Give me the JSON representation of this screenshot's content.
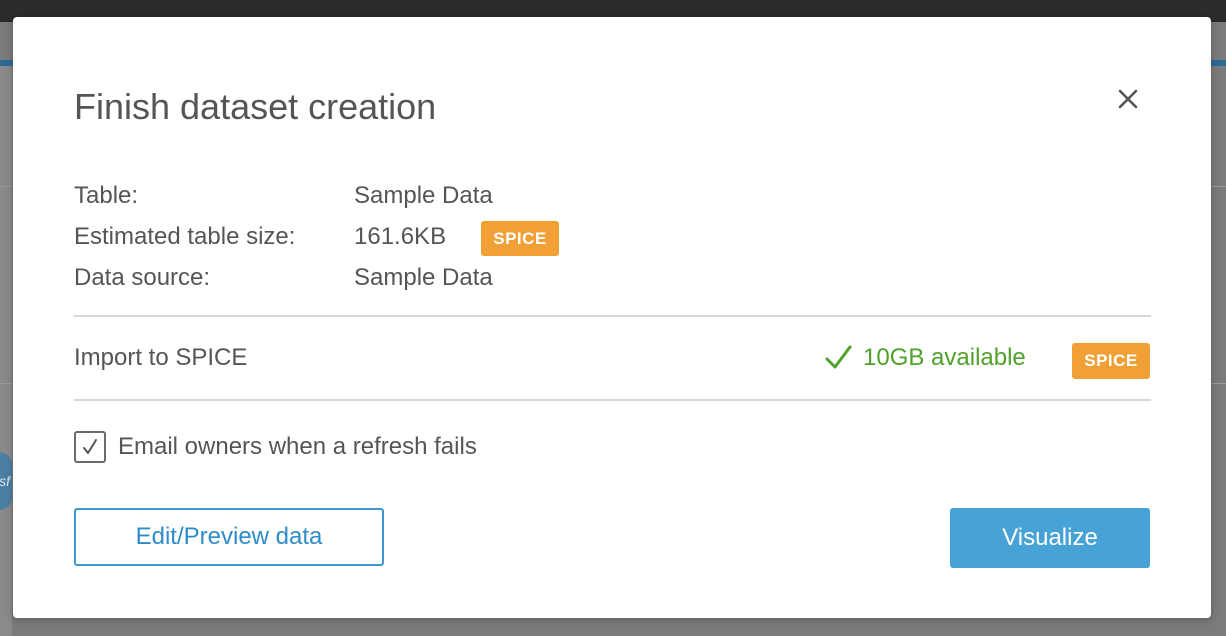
{
  "modal": {
    "title": "Finish dataset creation",
    "close_icon": "close-icon"
  },
  "details": [
    {
      "label": "Table:",
      "value": "Sample Data"
    },
    {
      "label": "Estimated table size:",
      "value": "161.6KB",
      "badge": "SPICE"
    },
    {
      "label": "Data source:",
      "value": "Sample Data"
    }
  ],
  "import": {
    "label": "Import to SPICE",
    "status_icon": "checkmark-icon",
    "available_text": "10GB available",
    "badge": "SPICE"
  },
  "email_option": {
    "checked": true,
    "label": "Email owners when a refresh fails"
  },
  "actions": {
    "edit_preview_label": "Edit/Preview data",
    "visualize_label": "Visualize"
  },
  "colors": {
    "badge_orange": "#f0a035",
    "success_green": "#4fa12a",
    "primary_blue": "#47a2d6",
    "link_blue": "#2f8cc9"
  }
}
